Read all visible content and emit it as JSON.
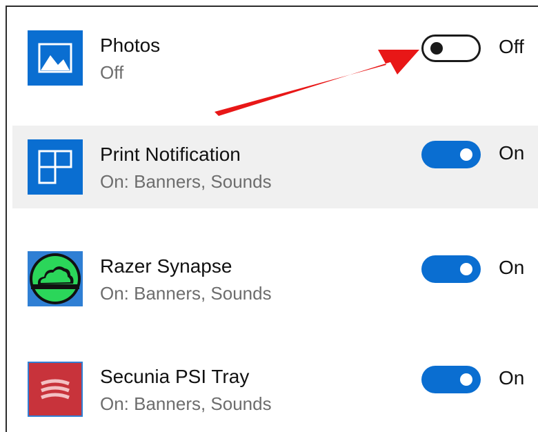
{
  "apps": [
    {
      "name": "Photos",
      "status": "Off",
      "toggle_label": "Off",
      "enabled": false,
      "icon": "photos-icon",
      "icon_color": "#0a6ed1"
    },
    {
      "name": "Print Notification",
      "status": "On: Banners, Sounds",
      "toggle_label": "On",
      "enabled": true,
      "icon": "print-notification-icon",
      "icon_color": "#0a6ed1"
    },
    {
      "name": "Razer Synapse",
      "status": "On: Banners, Sounds",
      "toggle_label": "On",
      "enabled": true,
      "icon": "razer-cloud-icon",
      "icon_color": "#1a1a1a"
    },
    {
      "name": "Secunia PSI Tray",
      "status": "On: Banners, Sounds",
      "toggle_label": "On",
      "enabled": true,
      "icon": "secunia-icon",
      "icon_color": "#c8333b"
    }
  ],
  "colors": {
    "toggle_on": "#0a6ed1",
    "highlight_row": "#f0f0f0",
    "annotation_arrow": "#e81717"
  }
}
